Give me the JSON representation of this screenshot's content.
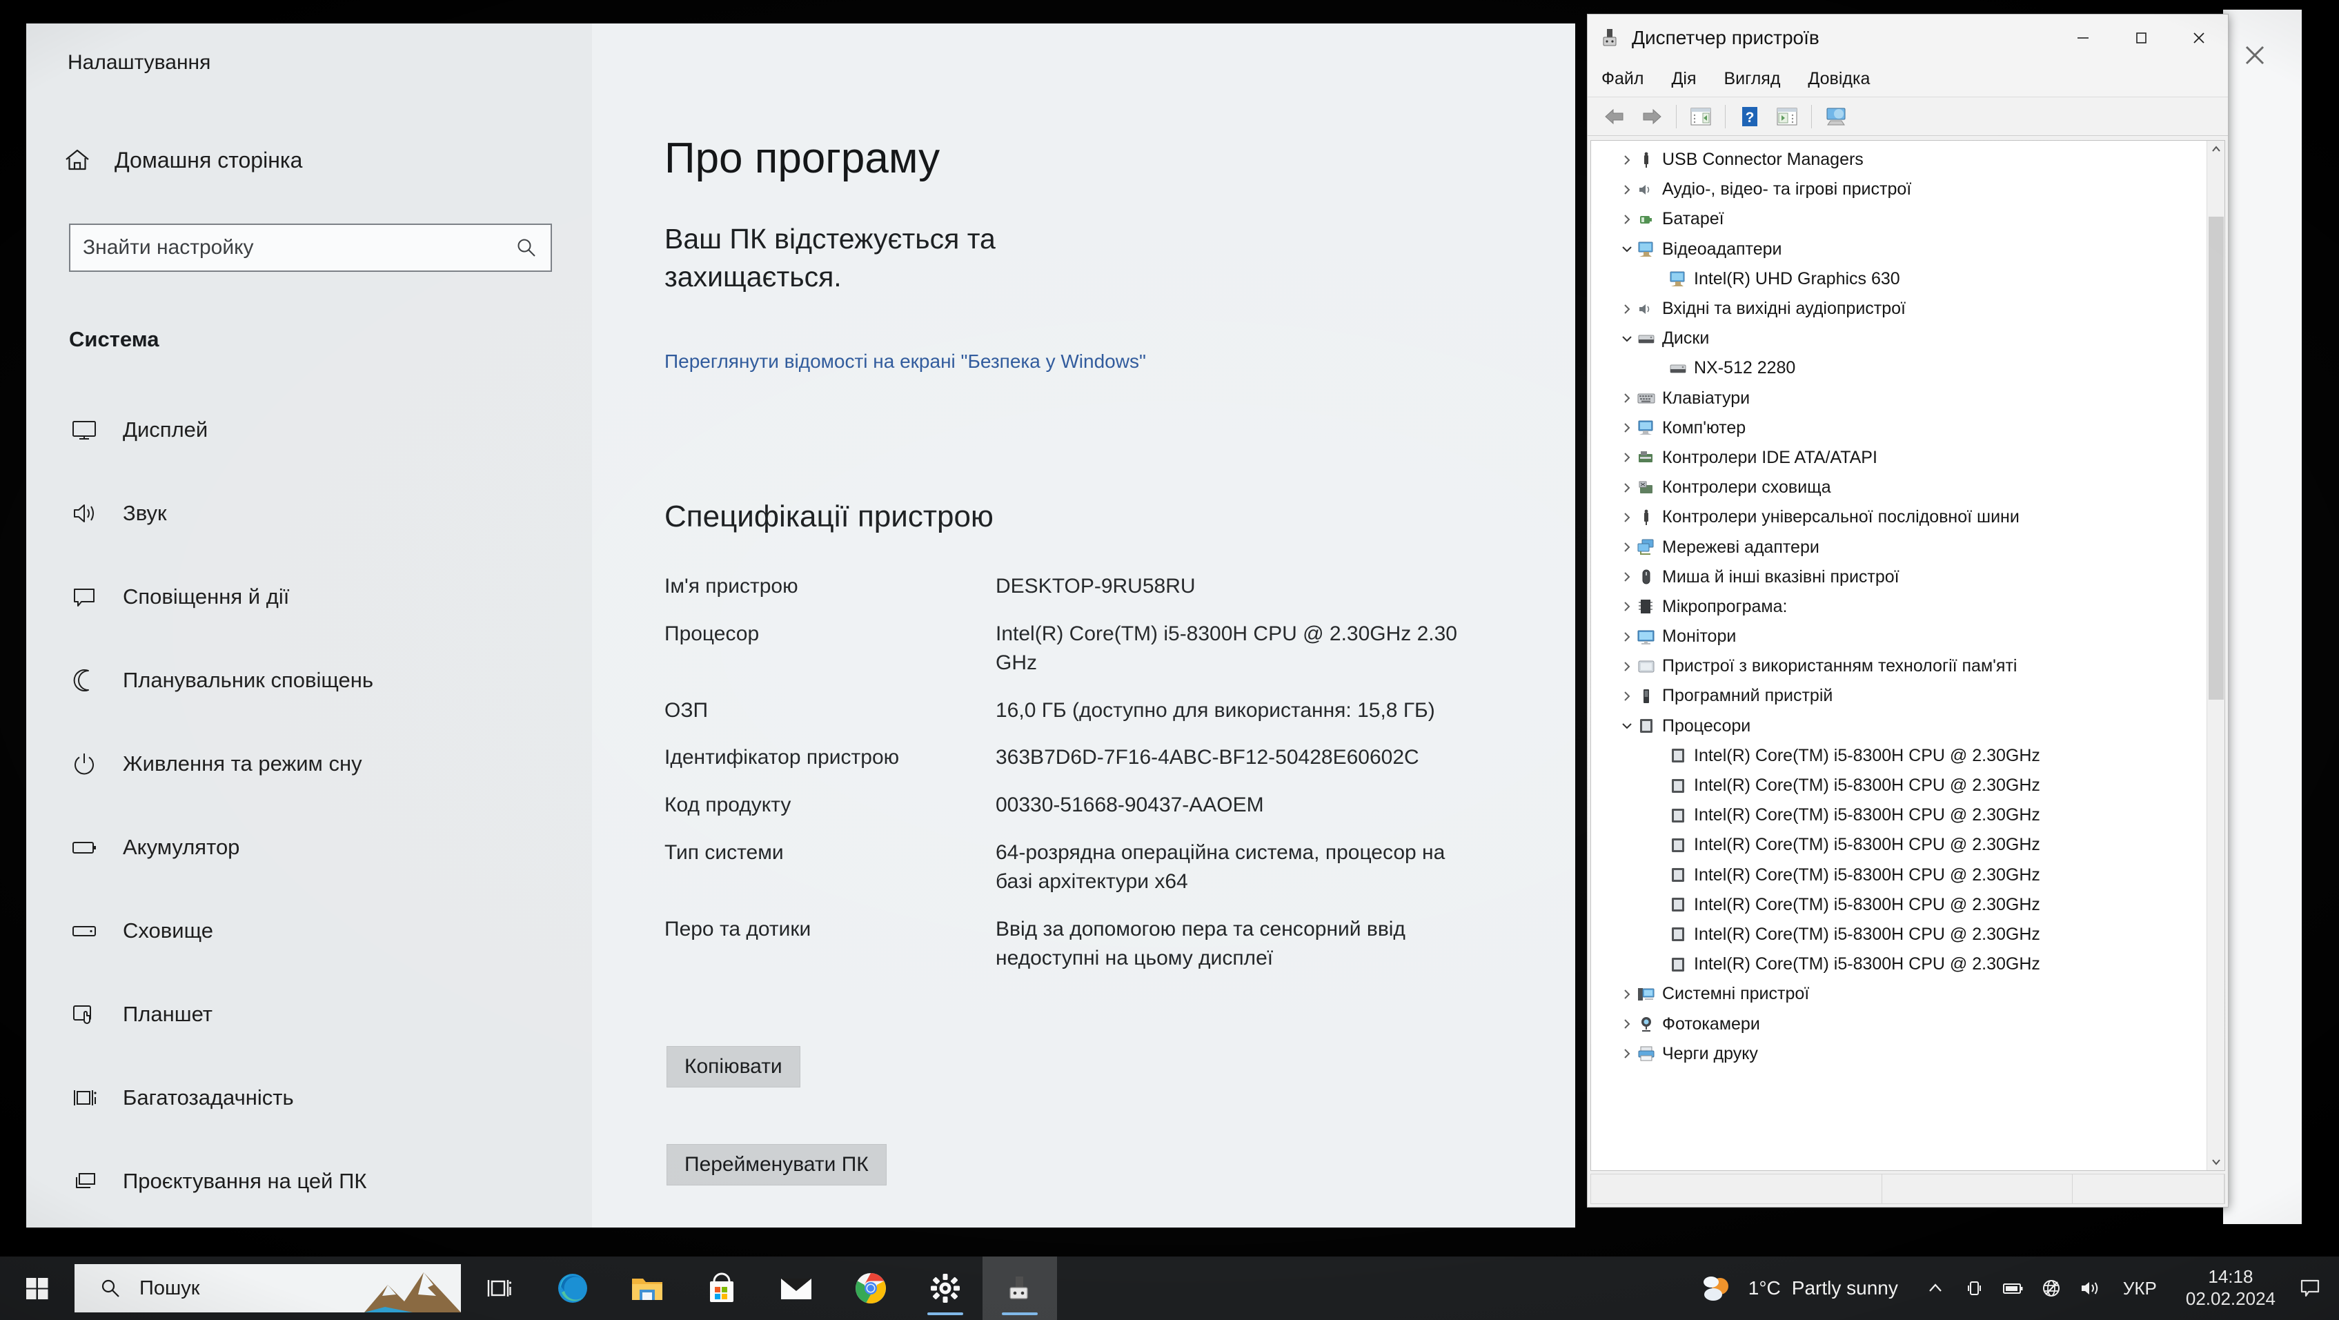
{
  "settings": {
    "window_title": "Налаштування",
    "home_label": "Домашня сторінка",
    "search_placeholder": "Знайти настройку",
    "group_title": "Система",
    "nav_items": [
      {
        "label": "Дисплей",
        "icon": "monitor-icon"
      },
      {
        "label": "Звук",
        "icon": "speaker-icon"
      },
      {
        "label": "Сповіщення й дії",
        "icon": "notification-icon"
      },
      {
        "label": "Планувальник сповіщень",
        "icon": "moon-icon"
      },
      {
        "label": "Живлення та режим сну",
        "icon": "power-icon"
      },
      {
        "label": "Акумулятор",
        "icon": "battery-icon"
      },
      {
        "label": "Сховище",
        "icon": "storage-icon"
      },
      {
        "label": "Планшет",
        "icon": "tablet-icon"
      },
      {
        "label": "Багатозадачність",
        "icon": "multitasking-icon"
      },
      {
        "label": "Проєктування на цей ПК",
        "icon": "project-icon"
      }
    ],
    "page_title": "Про програму",
    "protection_heading": "Ваш ПК відстежується та захищається.",
    "protection_link": "Переглянути відомості на екрані \"Безпека у Windows\"",
    "spec_heading": "Специфікації пристрою",
    "specs": [
      {
        "key": "Ім'я пристрою",
        "value": "DESKTOP-9RU58RU"
      },
      {
        "key": "Процесор",
        "value": "Intel(R) Core(TM) i5-8300H CPU @ 2.30GHz   2.30 GHz"
      },
      {
        "key": "ОЗП",
        "value": "16,0 ГБ (доступно для використання: 15,8 ГБ)"
      },
      {
        "key": "Ідентифікатор пристрою",
        "value": "363B7D6D-7F16-4ABC-BF12-50428E60602C"
      },
      {
        "key": "Код продукту",
        "value": "00330-51668-90437-AAOEM"
      },
      {
        "key": "Тип системи",
        "value": "64-розрядна операційна система, процесор на базі архітектури x64"
      },
      {
        "key": "Перо та дотики",
        "value": "Ввід за допомогою пера та сенсорний ввід недоступні на цьому дисплеї"
      }
    ],
    "copy_button": "Копіювати",
    "rename_button": "Перейменувати ПК"
  },
  "device_manager": {
    "title": "Диспетчер пристроїв",
    "title_icon": "device-manager-icon",
    "window_controls": {
      "minimize": "minimize-icon",
      "maximize": "maximize-icon",
      "close": "close-icon"
    },
    "menu": [
      "Файл",
      "Дія",
      "Вигляд",
      "Довідка"
    ],
    "toolbar_icons": [
      "back-arrow-icon",
      "forward-arrow-icon",
      "properties-icon",
      "help-icon",
      "update-driver-icon",
      "scan-hardware-icon"
    ],
    "tree": [
      {
        "label": "USB Connector Managers",
        "state": "collapsed",
        "level": 0,
        "icon": "usb-icon"
      },
      {
        "label": "Аудіо-, відео- та ігрові пристрої",
        "state": "collapsed",
        "level": 0,
        "icon": "speaker-icon"
      },
      {
        "label": "Батареї",
        "state": "collapsed",
        "level": 0,
        "icon": "battery-device-icon"
      },
      {
        "label": "Відеоадаптери",
        "state": "expanded",
        "level": 0,
        "icon": "display-adapter-icon"
      },
      {
        "label": "Intel(R) UHD Graphics 630",
        "state": "leaf",
        "level": 1,
        "icon": "display-adapter-icon"
      },
      {
        "label": "Вхідні та вихідні аудіопристрої",
        "state": "collapsed",
        "level": 0,
        "icon": "speaker-icon"
      },
      {
        "label": "Диски",
        "state": "expanded",
        "level": 0,
        "icon": "disk-icon"
      },
      {
        "label": "NX-512 2280",
        "state": "leaf",
        "level": 1,
        "icon": "disk-icon"
      },
      {
        "label": "Клавіатури",
        "state": "collapsed",
        "level": 0,
        "icon": "keyboard-icon"
      },
      {
        "label": "Комп'ютер",
        "state": "collapsed",
        "level": 0,
        "icon": "computer-icon"
      },
      {
        "label": "Контролери IDE ATA/ATAPI",
        "state": "collapsed",
        "level": 0,
        "icon": "ide-controller-icon"
      },
      {
        "label": "Контролери сховища",
        "state": "collapsed",
        "level": 0,
        "icon": "storage-controller-icon"
      },
      {
        "label": "Контролери універсальної послідовної шини",
        "state": "collapsed",
        "level": 0,
        "icon": "usb-icon"
      },
      {
        "label": "Мережеві адаптери",
        "state": "collapsed",
        "level": 0,
        "icon": "network-adapter-icon"
      },
      {
        "label": "Миша й інші вказівні пристрої",
        "state": "collapsed",
        "level": 0,
        "icon": "mouse-icon"
      },
      {
        "label": "Мікропрограма:",
        "state": "collapsed",
        "level": 0,
        "icon": "firmware-icon"
      },
      {
        "label": "Монітори",
        "state": "collapsed",
        "level": 0,
        "icon": "monitor-device-icon"
      },
      {
        "label": "Пристрої з використанням технології пам'яті",
        "state": "collapsed",
        "level": 0,
        "icon": "memory-icon"
      },
      {
        "label": "Програмний пристрій",
        "state": "collapsed",
        "level": 0,
        "icon": "software-device-icon"
      },
      {
        "label": "Процесори",
        "state": "expanded",
        "level": 0,
        "icon": "processor-icon"
      },
      {
        "label": "Intel(R) Core(TM) i5-8300H CPU @ 2.30GHz",
        "state": "leaf",
        "level": 1,
        "icon": "processor-icon"
      },
      {
        "label": "Intel(R) Core(TM) i5-8300H CPU @ 2.30GHz",
        "state": "leaf",
        "level": 1,
        "icon": "processor-icon"
      },
      {
        "label": "Intel(R) Core(TM) i5-8300H CPU @ 2.30GHz",
        "state": "leaf",
        "level": 1,
        "icon": "processor-icon"
      },
      {
        "label": "Intel(R) Core(TM) i5-8300H CPU @ 2.30GHz",
        "state": "leaf",
        "level": 1,
        "icon": "processor-icon"
      },
      {
        "label": "Intel(R) Core(TM) i5-8300H CPU @ 2.30GHz",
        "state": "leaf",
        "level": 1,
        "icon": "processor-icon"
      },
      {
        "label": "Intel(R) Core(TM) i5-8300H CPU @ 2.30GHz",
        "state": "leaf",
        "level": 1,
        "icon": "processor-icon"
      },
      {
        "label": "Intel(R) Core(TM) i5-8300H CPU @ 2.30GHz",
        "state": "leaf",
        "level": 1,
        "icon": "processor-icon"
      },
      {
        "label": "Intel(R) Core(TM) i5-8300H CPU @ 2.30GHz",
        "state": "leaf",
        "level": 1,
        "icon": "processor-icon"
      },
      {
        "label": "Системні пристрої",
        "state": "collapsed",
        "level": 0,
        "icon": "system-device-icon"
      },
      {
        "label": "Фотокамери",
        "state": "collapsed",
        "level": 0,
        "icon": "camera-icon"
      },
      {
        "label": "Черги друку",
        "state": "collapsed",
        "level": 0,
        "icon": "printer-icon"
      }
    ]
  },
  "taskbar": {
    "start_icon": "windows-start-icon",
    "search_placeholder": "Пошук",
    "search_icon": "search-icon",
    "pinned": [
      {
        "name": "task-view-icon",
        "label": "Подання завдань"
      },
      {
        "name": "edge-icon",
        "label": "Microsoft Edge"
      },
      {
        "name": "file-explorer-icon",
        "label": "Провідник"
      },
      {
        "name": "microsoft-store-icon",
        "label": "Microsoft Store"
      },
      {
        "name": "mail-icon",
        "label": "Пошта"
      },
      {
        "name": "chrome-icon",
        "label": "Google Chrome"
      },
      {
        "name": "settings-icon",
        "label": "Налаштування"
      },
      {
        "name": "device-manager-icon",
        "label": "Диспетчер пристроїв"
      }
    ],
    "weather": {
      "temperature": "1°C",
      "condition": "Partly sunny",
      "icon": "partly-sunny-icon"
    },
    "tray": [
      {
        "name": "show-hidden-icons-chevron",
        "glyph": "^"
      },
      {
        "name": "phone-link-icon"
      },
      {
        "name": "battery-tray-icon"
      },
      {
        "name": "network-disconnected-icon"
      },
      {
        "name": "volume-icon"
      }
    ],
    "language": "УКР",
    "clock_time": "14:18",
    "clock_date": "02.02.2024",
    "notification_icon": "notification-center-icon"
  },
  "colors": {
    "accent_link": "#2a5699",
    "taskbar_bg": "#1b1d1f",
    "settings_sidebar": "#e7eaec",
    "settings_main": "#eef1f3"
  }
}
